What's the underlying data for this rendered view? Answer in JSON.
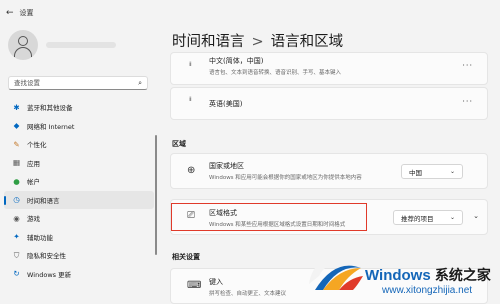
{
  "window": {
    "title": "设置"
  },
  "sidebar": {
    "search_placeholder": "查找设置",
    "items": [
      {
        "label": "蓝牙和其他设备",
        "icon": "bluetooth-icon"
      },
      {
        "label": "网络和 Internet",
        "icon": "wifi-icon"
      },
      {
        "label": "个性化",
        "icon": "brush-icon"
      },
      {
        "label": "应用",
        "icon": "apps-icon"
      },
      {
        "label": "帐户",
        "icon": "person-icon"
      },
      {
        "label": "时间和语言",
        "icon": "globe-clock-icon",
        "active": true
      },
      {
        "label": "游戏",
        "icon": "gamepad-icon"
      },
      {
        "label": "辅助功能",
        "icon": "accessibility-icon"
      },
      {
        "label": "隐私和安全性",
        "icon": "shield-icon"
      },
      {
        "label": "Windows 更新",
        "icon": "update-icon"
      }
    ]
  },
  "breadcrumb": {
    "parent": "时间和语言",
    "separator": ">",
    "current": "语言和区域"
  },
  "languages": [
    {
      "name": "中文(简体，中国)",
      "features": "语言包、文本到语音转换、语音识别、手写、基本键入"
    },
    {
      "name": "英语(美国)"
    }
  ],
  "more_glyph": "···",
  "region_section": {
    "label": "区域",
    "country": {
      "title": "国家或地区",
      "desc": "Windows 和应用可能会根据你的国家或地区为你提供本地内容",
      "value": "中国"
    },
    "format": {
      "title": "区域格式",
      "desc": "Windows 和某些应用根据区域格式设置日期和时间格式",
      "value": "推荐的项目"
    }
  },
  "related_section": {
    "label": "相关设置",
    "input": {
      "title": "键入",
      "desc": "拼写检查、自动更正、文本建议"
    }
  },
  "watermark": {
    "brand": "Windows",
    "cn": "系统之家",
    "url": "www.xitongzhijia.net"
  },
  "colors": {
    "accent": "#0067c0",
    "highlight": "#e03a2a",
    "watermark": "#1466b8"
  }
}
